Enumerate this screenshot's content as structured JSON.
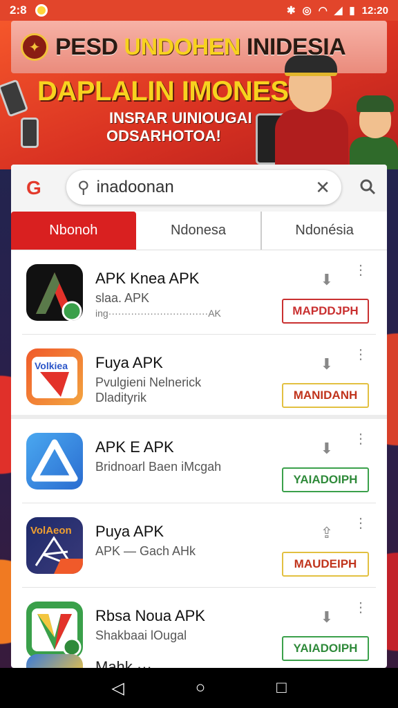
{
  "status_bar": {
    "time_left": "2:8",
    "time_right": "12:20",
    "icons": [
      "notification-dot",
      "bluetooth",
      "alarm",
      "wifi",
      "signal",
      "battery"
    ]
  },
  "banner": {
    "top_title_part1": "PESD",
    "top_title_part2": "UNDOHEN",
    "top_title_part3": "INIDESIA",
    "headline": "DAPLALIN IMONESIA",
    "sub_line1": "INSRAR UINIOUGAI",
    "sub_line2": "ODSARHOTOA!"
  },
  "search": {
    "logo": "G",
    "query": "inadoonan"
  },
  "tabs": [
    {
      "label": "Nbonoh",
      "active": true
    },
    {
      "label": "Ndonesa",
      "active": false
    },
    {
      "label": "Ndonésia",
      "active": false
    }
  ],
  "apps": [
    {
      "title": "APK Knea APK",
      "sub1": "slaa. APK",
      "sub2": "ing·······························AK",
      "button": "MAPDDJPH",
      "button_style": "red",
      "icon_colors": [
        "#111111",
        "#e3322a",
        "#3aa04a"
      ]
    },
    {
      "title": "Fuya APK",
      "sub1": "Pvulgieni Nelnerick",
      "sub2": "Dladityrik",
      "button": "MANIDANH",
      "button_style": "yellow",
      "icon_colors": [
        "#f05a2a",
        "#ffffff",
        "#2a55c8"
      ]
    },
    {
      "title": "APK E APK",
      "sub1": "Bridnoarl Baen iMcgah",
      "sub2": "",
      "button": "YAIADOIPH",
      "button_style": "green",
      "icon_colors": [
        "#3c8ee6",
        "#ffffff"
      ]
    },
    {
      "title": "Puya APK",
      "sub1": "APK  —  Gach AHk",
      "sub2": "",
      "button": "MAUDEIPH",
      "button_style": "yellow",
      "icon_colors": [
        "#1e2a6a",
        "#f0a030"
      ]
    },
    {
      "title": "Rbsa Noua APK",
      "sub1": "Shakbaai lOugal",
      "sub2": "",
      "button": "YAIADOIPH",
      "button_style": "green",
      "icon_colors": [
        "#3aa04a",
        "#f3c640",
        "#e3322a"
      ]
    }
  ],
  "partial_item": {
    "title": "Mahk ··· "
  },
  "nav": {
    "back": "◁",
    "home": "○",
    "recents": "□"
  }
}
